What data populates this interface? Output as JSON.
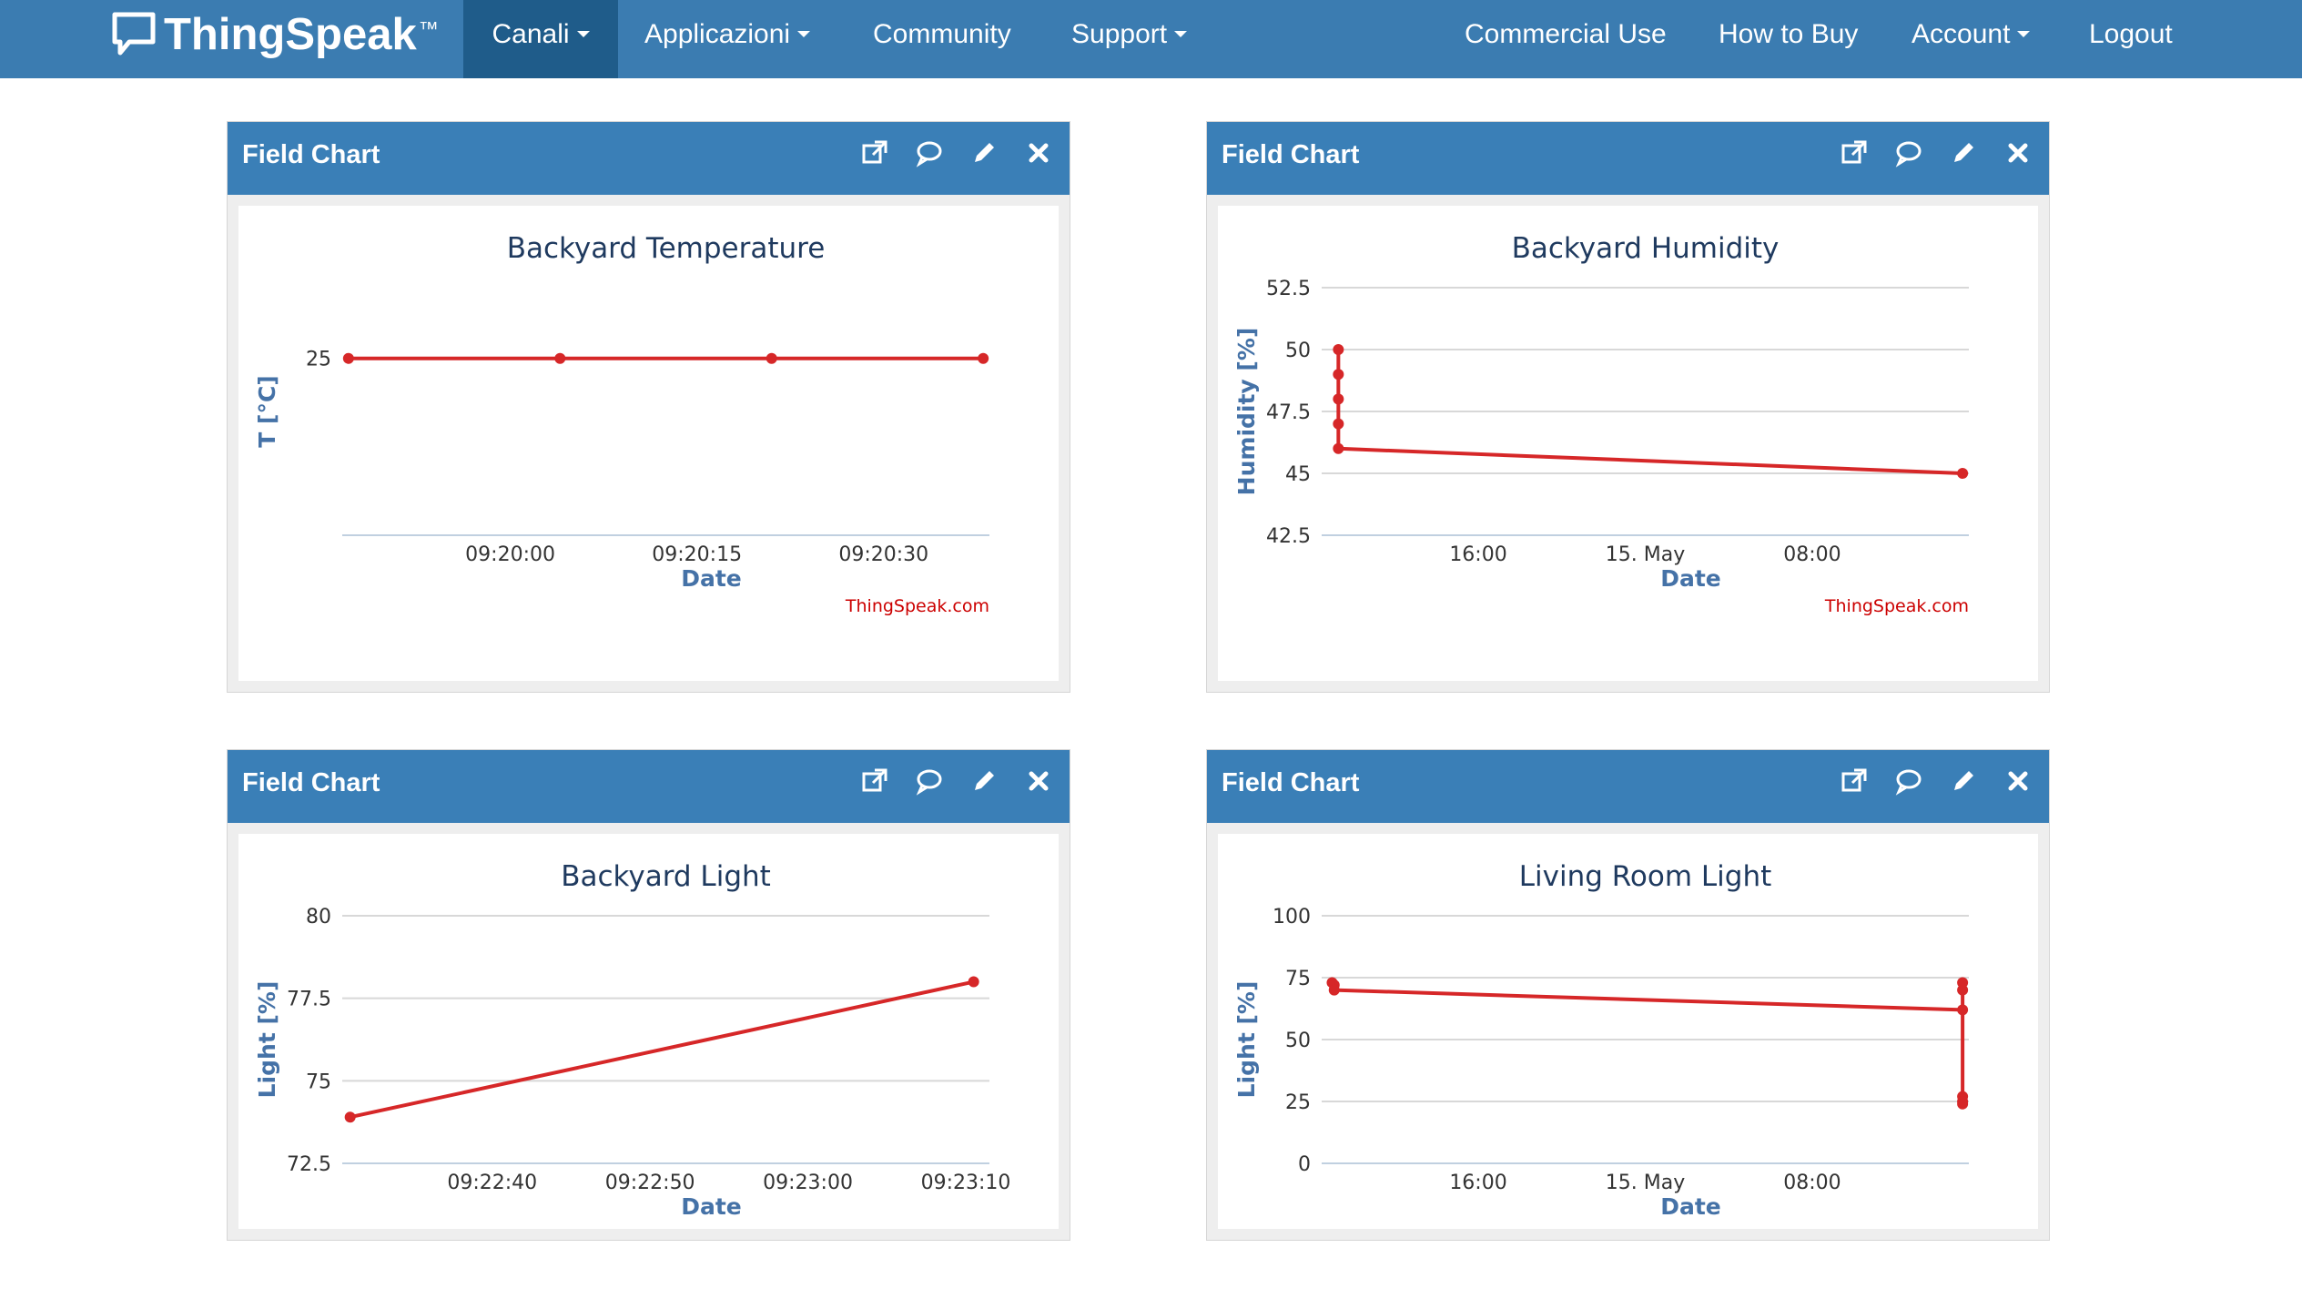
{
  "nav": {
    "brand": "ThingSpeak",
    "brand_tm": "™",
    "items": [
      {
        "label": "Canali",
        "dropdown": true,
        "active": true
      },
      {
        "label": "Applicazioni",
        "dropdown": true
      },
      {
        "label": "Community",
        "dropdown": false
      },
      {
        "label": "Support",
        "dropdown": true
      },
      {
        "label": "Commercial Use",
        "dropdown": false
      },
      {
        "label": "How to Buy",
        "dropdown": false
      },
      {
        "label": "Account",
        "dropdown": true
      },
      {
        "label": "Logout",
        "dropdown": false
      }
    ]
  },
  "colors": {
    "navbar": "#3b7cb1",
    "navbar_active": "#1f5c8a",
    "panel_header": "#3a7fb7",
    "series": "#d62728",
    "credit": "#cc0000"
  },
  "panels": [
    {
      "header": "Field Chart",
      "icons": [
        "external-link-icon",
        "comment-icon",
        "edit-pencil-icon",
        "close-icon"
      ]
    },
    {
      "header": "Field Chart",
      "icons": [
        "external-link-icon",
        "comment-icon",
        "edit-pencil-icon",
        "close-icon"
      ]
    },
    {
      "header": "Field Chart",
      "icons": [
        "external-link-icon",
        "comment-icon",
        "edit-pencil-icon",
        "close-icon"
      ]
    },
    {
      "header": "Field Chart",
      "icons": [
        "external-link-icon",
        "comment-icon",
        "edit-pencil-icon",
        "close-icon"
      ]
    }
  ],
  "chart_data": [
    {
      "type": "line",
      "title": "Backyard Temperature",
      "xlabel": "Date",
      "ylabel": "T [°C]",
      "credit": "ThingSpeak.com",
      "x_tick_labels": [
        "09:20:00",
        "09:20:15",
        "09:20:30"
      ],
      "x_tick_values": [
        0,
        15,
        30
      ],
      "xlim": [
        -13.5,
        38.5
      ],
      "y_tick_labels": [
        "25"
      ],
      "y_tick_values": [
        25
      ],
      "ylim": [
        20,
        27
      ],
      "grid": false,
      "show_y_gridlines": false,
      "series": [
        {
          "x": [
            -13,
            4,
            21,
            38
          ],
          "values": [
            25,
            25,
            25,
            25
          ]
        }
      ]
    },
    {
      "type": "line",
      "title": "Backyard Humidity",
      "xlabel": "Date",
      "ylabel": "Humidity [%]",
      "credit": "ThingSpeak.com",
      "x_tick_labels": [
        "16:00",
        "15. May",
        "08:00"
      ],
      "x_tick_values": [
        16,
        24,
        32
      ],
      "xlim": [
        8.5,
        39.5
      ],
      "y_tick_labels": [
        "42.5",
        "45",
        "47.5",
        "50",
        "52.5"
      ],
      "y_tick_values": [
        42.5,
        45,
        47.5,
        50,
        52.5
      ],
      "ylim": [
        42.5,
        52.5
      ],
      "grid": true,
      "show_y_gridlines": true,
      "series": [
        {
          "x": [
            9.3,
            9.3,
            9.3,
            9.3,
            9.3,
            39.2
          ],
          "values": [
            50,
            49,
            48,
            47,
            46,
            45
          ]
        }
      ]
    },
    {
      "type": "line",
      "title": "Backyard Light",
      "xlabel": "Date",
      "ylabel": "Light [%]",
      "credit": "",
      "x_tick_labels": [
        "09:22:40",
        "09:22:50",
        "09:23:00",
        "09:23:10"
      ],
      "x_tick_values": [
        40,
        50,
        60,
        70
      ],
      "xlim": [
        30.5,
        71.5
      ],
      "y_tick_labels": [
        "72.5",
        "75",
        "77.5",
        "80"
      ],
      "y_tick_values": [
        72.5,
        75,
        77.5,
        80
      ],
      "ylim": [
        72.5,
        80
      ],
      "grid": true,
      "show_y_gridlines": true,
      "series": [
        {
          "x": [
            31,
            70.5
          ],
          "values": [
            73.9,
            78
          ]
        }
      ]
    },
    {
      "type": "line",
      "title": "Living Room Light",
      "xlabel": "Date",
      "ylabel": "Light [%]",
      "credit": "",
      "x_tick_labels": [
        "16:00",
        "15. May",
        "08:00"
      ],
      "x_tick_values": [
        16,
        24,
        32
      ],
      "xlim": [
        8.5,
        39.5
      ],
      "y_tick_labels": [
        "0",
        "25",
        "50",
        "75",
        "100"
      ],
      "y_tick_values": [
        0,
        25,
        50,
        75,
        100
      ],
      "ylim": [
        0,
        100
      ],
      "grid": true,
      "show_y_gridlines": true,
      "series": [
        {
          "x": [
            9.0,
            9.1,
            9.1,
            39.2,
            39.2,
            39.2,
            39.2,
            39.2,
            39.2
          ],
          "values": [
            73,
            72,
            70,
            62,
            70,
            73,
            27,
            25,
            24
          ]
        }
      ]
    }
  ]
}
